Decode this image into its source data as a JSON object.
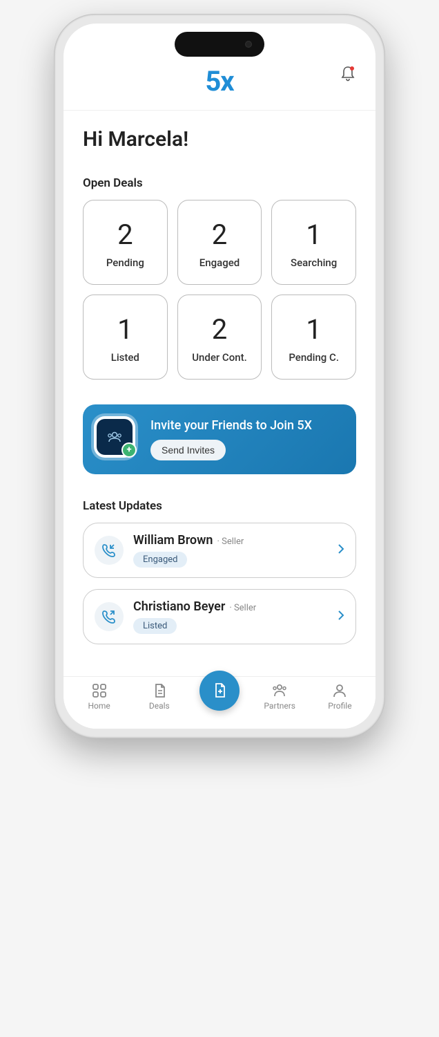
{
  "header": {
    "logo": "5x"
  },
  "greeting": "Hi Marcela!",
  "open_deals": {
    "title": "Open Deals",
    "cards": [
      {
        "count": "2",
        "label": "Pending"
      },
      {
        "count": "2",
        "label": "Engaged"
      },
      {
        "count": "1",
        "label": "Searching"
      },
      {
        "count": "1",
        "label": "Listed"
      },
      {
        "count": "2",
        "label": "Under Cont."
      },
      {
        "count": "1",
        "label": "Pending C."
      }
    ]
  },
  "invite": {
    "title": "Invite your Friends to Join 5X",
    "button": "Send Invites"
  },
  "updates": {
    "title": "Latest Updates",
    "items": [
      {
        "name": "William Brown",
        "role": "Seller",
        "status": "Engaged",
        "direction": "in"
      },
      {
        "name": "Christiano Beyer",
        "role": "Seller",
        "status": "Listed",
        "direction": "out"
      }
    ]
  },
  "tabs": [
    {
      "label": "Home"
    },
    {
      "label": "Deals"
    },
    {
      "label": "Partners"
    },
    {
      "label": "Profile"
    }
  ]
}
